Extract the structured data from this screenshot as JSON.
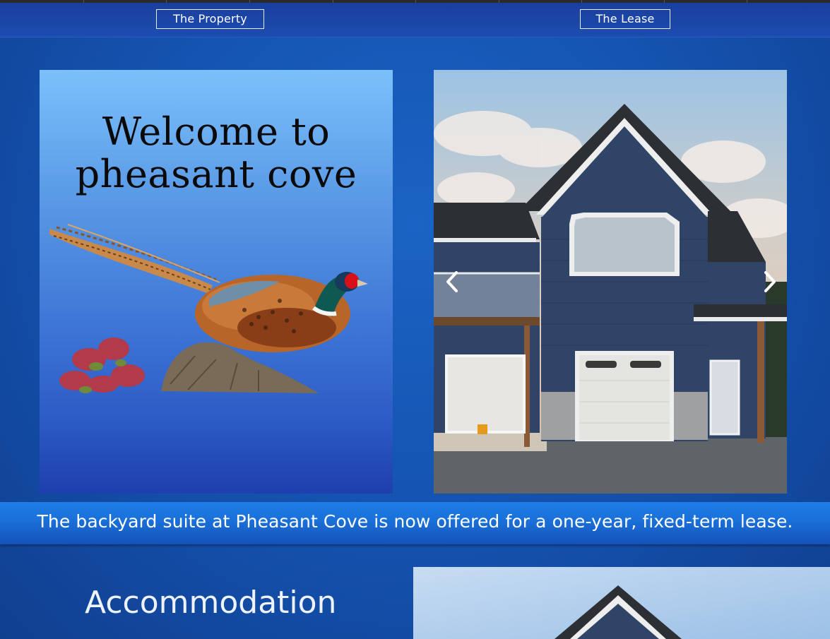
{
  "nav": {
    "property_label": "The Property",
    "lease_label": "The Lease"
  },
  "hero": {
    "welcome_line1": "Welcome to",
    "welcome_line2": "pheasant cove",
    "carousel_prev_icon": "chevron-left-icon",
    "carousel_next_icon": "chevron-right-icon"
  },
  "banner": {
    "text": "The backyard suite at Pheasant Cove is now offered for a one-year, fixed-term lease."
  },
  "accommodation": {
    "title": "Accommodation"
  },
  "colors": {
    "nav_background": "#1c4cb0",
    "page_background": "#1451ad",
    "banner_background": "#1a6fd8",
    "house_siding": "#2f4466"
  }
}
